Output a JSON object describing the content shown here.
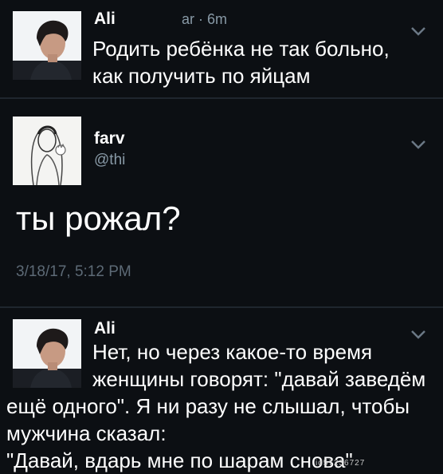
{
  "tweet1": {
    "name": "Ali",
    "meta": "ar · 6m",
    "lines": [
      "Родить ребёнка не так больно,",
      "как получить по яйцам"
    ],
    "menu_icon": "chevron-down-icon",
    "avatar_icon": "profile-photo"
  },
  "tweet2": {
    "name": "farv",
    "handle": "@thi",
    "text": "ты рожал?",
    "timestamp": "3/18/17, 5:12 PM",
    "menu_icon": "chevron-down-icon",
    "avatar_icon": "drawn-profile-photo"
  },
  "tweet3": {
    "name": "Ali",
    "lines": [
      "Нет, но через какое-то время",
      "женщины говорят: \"давай заведём",
      "ещё одного\". Я ни разу не слышал, чтобы",
      "мужчина сказал:",
      "\"Давай, вдарь мне по шарам снова\""
    ],
    "menu_icon": "chevron-down-icon",
    "avatar_icon": "profile-photo"
  },
  "watermark": "id57236727",
  "colors": {
    "background": "#0c0f13",
    "text": "#ffffff",
    "secondary": "#8899a6",
    "divider": "#1f262e"
  }
}
